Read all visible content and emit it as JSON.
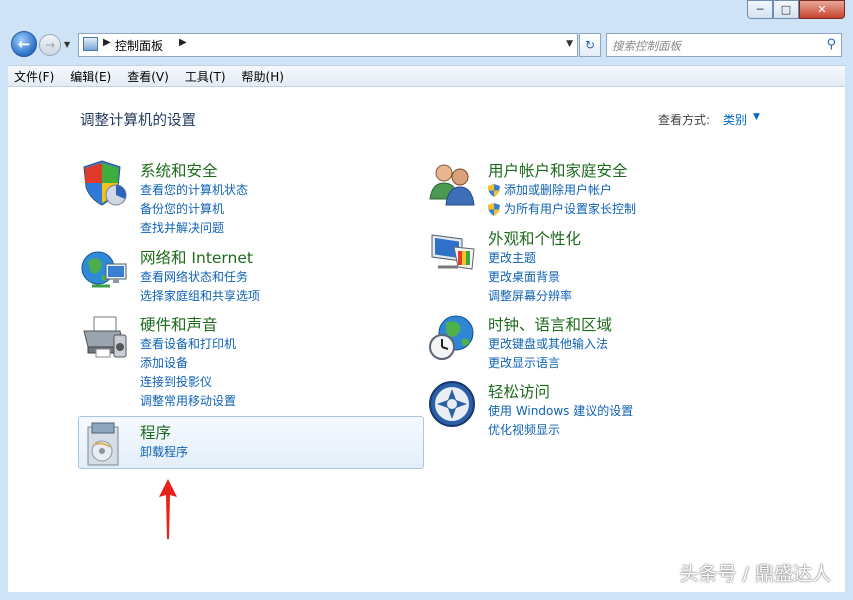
{
  "titlebar": {
    "minimize": "─",
    "maximize": "□",
    "close": "✕"
  },
  "nav": {
    "back": "←",
    "forward": "→",
    "breadcrumb": "控制面板",
    "refresh": "↻",
    "search_placeholder": "搜索控制面板"
  },
  "menu": [
    "文件(F)",
    "编辑(E)",
    "查看(V)",
    "工具(T)",
    "帮助(H)"
  ],
  "page": {
    "title": "调整计算机的设置",
    "view_by_label": "查看方式:",
    "view_by_value": "类别"
  },
  "categories_left": [
    {
      "title": "系统和安全",
      "icon": "shield-pie-icon",
      "links": [
        "查看您的计算机状态",
        "备份您的计算机",
        "查找并解决问题"
      ]
    },
    {
      "title": "网络和 Internet",
      "icon": "globe-network-icon",
      "links": [
        "查看网络状态和任务",
        "选择家庭组和共享选项"
      ]
    },
    {
      "title": "硬件和声音",
      "icon": "printer-icon",
      "links": [
        "查看设备和打印机",
        "添加设备",
        "连接到投影仪",
        "调整常用移动设置"
      ]
    },
    {
      "title": "程序",
      "icon": "programs-icon",
      "links": [
        "卸载程序"
      ]
    }
  ],
  "categories_right": [
    {
      "title": "用户帐户和家庭安全",
      "icon": "users-icon",
      "links": [
        "添加或删除用户帐户",
        "为所有用户设置家长控制"
      ]
    },
    {
      "title": "外观和个性化",
      "icon": "monitor-palette-icon",
      "links": [
        "更改主题",
        "更改桌面背景",
        "调整屏幕分辨率"
      ]
    },
    {
      "title": "时钟、语言和区域",
      "icon": "clock-globe-icon",
      "links": [
        "更改键盘或其他输入法",
        "更改显示语言"
      ]
    },
    {
      "title": "轻松访问",
      "icon": "ease-of-access-icon",
      "links": [
        "使用 Windows 建议的设置",
        "优化视频显示"
      ]
    }
  ],
  "watermark": "头条号 / 鼎盛达人"
}
